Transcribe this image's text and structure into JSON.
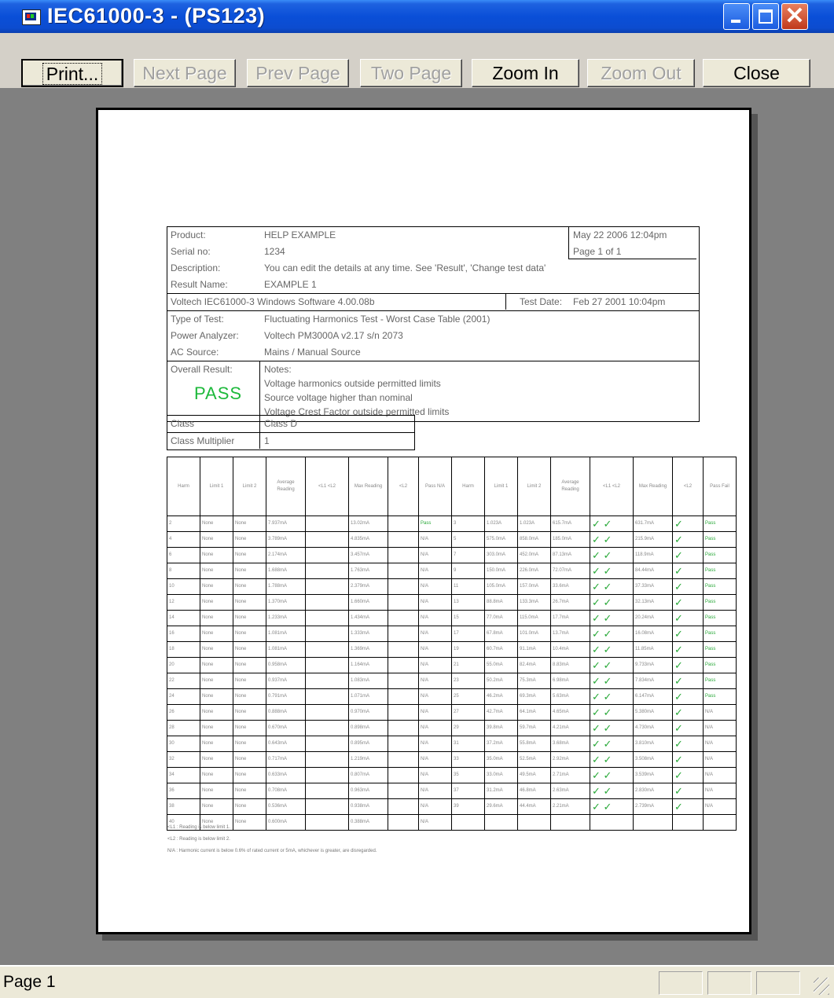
{
  "window": {
    "title": "IEC61000-3 - (PS123)",
    "close_glyph": "✕"
  },
  "toolbar": {
    "print": "Print...",
    "next_page": "Next Page",
    "prev_page": "Prev Page",
    "two_page": "Two Page",
    "zoom_in": "Zoom In",
    "zoom_out": "Zoom Out",
    "close": "Close"
  },
  "report": {
    "product_label": "Product:",
    "product": "HELP EXAMPLE",
    "datetime": "May 22 2006  12:04pm",
    "serial_label": "Serial no:",
    "serial": "1234",
    "page": "Page 1 of 1",
    "description_label": "Description:",
    "description": "You can edit the details at any time. See 'Result', 'Change test data'",
    "result_name_label": "Result Name:",
    "result_name": "EXAMPLE 1",
    "software": "Voltech IEC61000-3 Windows Software  4.00.08b",
    "test_date_label": "Test Date:",
    "test_date": "Feb 27 2001  10:04pm",
    "type_label": "Type of Test:",
    "type": "Fluctuating Harmonics Test - Worst Case Table (2001)",
    "analyzer_label": "Power Analyzer:",
    "analyzer": "Voltech PM3000A  v2.17  s/n 2073",
    "source_label": "AC Source:",
    "source": "Mains / Manual Source",
    "overall_label": "Overall Result:",
    "overall": "PASS",
    "notes_label": "Notes:",
    "note1": "Voltage harmonics outside permitted limits",
    "note2": "Source voltage higher than nominal",
    "note3": "Voltage Crest Factor outside permitted limits",
    "class_label": "Class",
    "class_value": "Class D",
    "multiplier_label": "Class Multiplier",
    "multiplier_value": "1"
  },
  "grid_headers": [
    "Harm",
    "Limit 1",
    "Limit 2",
    "Average Reading",
    "<L1 <L2",
    "Max Reading",
    "<L2",
    "Pass N/A",
    "Harm",
    "Limit 1",
    "Limit 2",
    "Average Reading",
    "<L1 <L2",
    "Max Reading",
    "<L2",
    "Pass Fail"
  ],
  "grid_rows": [
    [
      "2",
      "None",
      "None",
      "7.937mA",
      "",
      "13.02mA",
      "",
      "Pass",
      "3",
      "1.023A",
      "1.023A",
      "615.7mA",
      "✓ ✓",
      "631.7mA",
      "✓",
      "Pass"
    ],
    [
      "4",
      "None",
      "None",
      "3.789mA",
      "",
      "4.835mA",
      "",
      "N/A",
      "5",
      "575.0mA",
      "858.0mA",
      "185.0mA",
      "✓ ✓",
      "215.9mA",
      "✓",
      "Pass"
    ],
    [
      "6",
      "None",
      "None",
      "2.174mA",
      "",
      "3.457mA",
      "",
      "N/A",
      "7",
      "303.0mA",
      "452.0mA",
      "87.13mA",
      "✓ ✓",
      "118.9mA",
      "✓",
      "Pass"
    ],
    [
      "8",
      "None",
      "None",
      "1.688mA",
      "",
      "1.763mA",
      "",
      "N/A",
      "9",
      "150.0mA",
      "226.0mA",
      "72.07mA",
      "✓ ✓",
      "84.44mA",
      "✓",
      "Pass"
    ],
    [
      "10",
      "None",
      "None",
      "1.788mA",
      "",
      "2.379mA",
      "",
      "N/A",
      "11",
      "105.0mA",
      "157.0mA",
      "33.6mA",
      "✓ ✓",
      "37.33mA",
      "✓",
      "Pass"
    ],
    [
      "12",
      "None",
      "None",
      "1.370mA",
      "",
      "1.660mA",
      "",
      "N/A",
      "13",
      "88.8mA",
      "133.3mA",
      "26.7mA",
      "✓ ✓",
      "32.13mA",
      "✓",
      "Pass"
    ],
    [
      "14",
      "None",
      "None",
      "1.233mA",
      "",
      "1.434mA",
      "",
      "N/A",
      "15",
      "77.0mA",
      "115.0mA",
      "17.7mA",
      "✓ ✓",
      "20.24mA",
      "✓",
      "Pass"
    ],
    [
      "16",
      "None",
      "None",
      "1.081mA",
      "",
      "1.333mA",
      "",
      "N/A",
      "17",
      "67.8mA",
      "101.0mA",
      "13.7mA",
      "✓ ✓",
      "16.08mA",
      "✓",
      "Pass"
    ],
    [
      "18",
      "None",
      "None",
      "1.081mA",
      "",
      "1.369mA",
      "",
      "N/A",
      "19",
      "60.7mA",
      "91.1mA",
      "10.4mA",
      "✓ ✓",
      "11.85mA",
      "✓",
      "Pass"
    ],
    [
      "20",
      "None",
      "None",
      "0.958mA",
      "",
      "1.164mA",
      "",
      "N/A",
      "21",
      "55.0mA",
      "82.4mA",
      "8.83mA",
      "✓ ✓",
      "9.733mA",
      "✓",
      "Pass"
    ],
    [
      "22",
      "None",
      "None",
      "0.937mA",
      "",
      "1.083mA",
      "",
      "N/A",
      "23",
      "50.2mA",
      "75.3mA",
      "6.98mA",
      "✓ ✓",
      "7.834mA",
      "✓",
      "Pass"
    ],
    [
      "24",
      "None",
      "None",
      "0.791mA",
      "",
      "1.071mA",
      "",
      "N/A",
      "25",
      "46.2mA",
      "69.3mA",
      "5.63mA",
      "✓ ✓",
      "6.147mA",
      "✓",
      "Pass"
    ],
    [
      "26",
      "None",
      "None",
      "0.888mA",
      "",
      "0.970mA",
      "",
      "N/A",
      "27",
      "42.7mA",
      "64.1mA",
      "4.65mA",
      "✓ ✓",
      "5.380mA",
      "✓",
      "N/A"
    ],
    [
      "28",
      "None",
      "None",
      "0.670mA",
      "",
      "0.898mA",
      "",
      "N/A",
      "29",
      "39.8mA",
      "59.7mA",
      "4.21mA",
      "✓ ✓",
      "4.730mA",
      "✓",
      "N/A"
    ],
    [
      "30",
      "None",
      "None",
      "0.643mA",
      "",
      "0.895mA",
      "",
      "N/A",
      "31",
      "37.2mA",
      "55.8mA",
      "3.68mA",
      "✓ ✓",
      "3.810mA",
      "✓",
      "N/A"
    ],
    [
      "32",
      "None",
      "None",
      "0.717mA",
      "",
      "1.219mA",
      "",
      "N/A",
      "33",
      "35.0mA",
      "52.5mA",
      "2.92mA",
      "✓ ✓",
      "3.508mA",
      "✓",
      "N/A"
    ],
    [
      "34",
      "None",
      "None",
      "0.633mA",
      "",
      "0.807mA",
      "",
      "N/A",
      "35",
      "33.0mA",
      "49.5mA",
      "2.71mA",
      "✓ ✓",
      "3.539mA",
      "✓",
      "N/A"
    ],
    [
      "36",
      "None",
      "None",
      "0.708mA",
      "",
      "0.963mA",
      "",
      "N/A",
      "37",
      "31.2mA",
      "46.8mA",
      "2.63mA",
      "✓ ✓",
      "2.830mA",
      "✓",
      "N/A"
    ],
    [
      "38",
      "None",
      "None",
      "0.536mA",
      "",
      "0.938mA",
      "",
      "N/A",
      "39",
      "29.6mA",
      "44.4mA",
      "2.21mA",
      "✓ ✓",
      "2.739mA",
      "✓",
      "N/A"
    ],
    [
      "40",
      "None",
      "None",
      "0.600mA",
      "",
      "0.388mA",
      "",
      "N/A",
      "",
      "",
      "",
      "",
      "",
      "",
      "",
      ""
    ]
  ],
  "grid_notes": [
    "<L1 : Reading is below limit 1.",
    "<L2 : Reading is below limit 2.",
    "N/A : Harmonic current is below 0.6% of rated current or 5mA, whichever is greater, are disregarded."
  ],
  "status": {
    "text": "Page 1"
  }
}
